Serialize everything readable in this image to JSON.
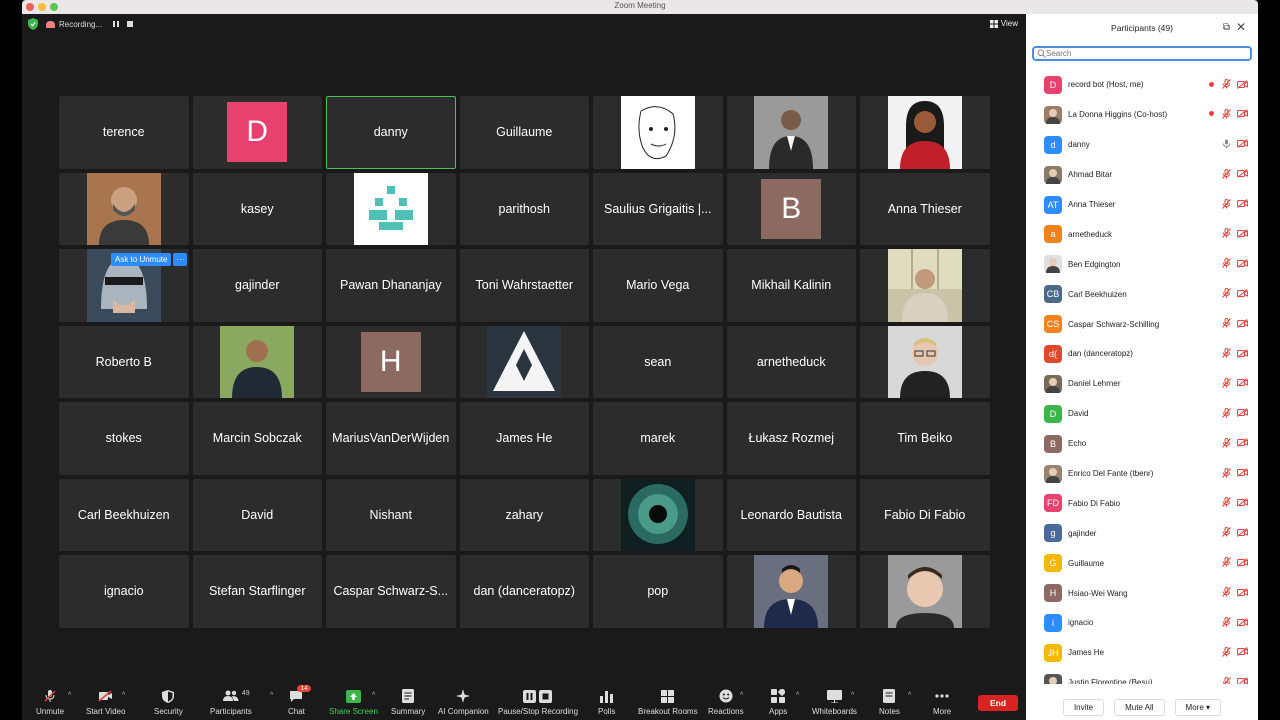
{
  "window": {
    "title": "Zoom Meeting"
  },
  "topbar": {
    "recording_label": "Recording...",
    "view_label": "View"
  },
  "tiles": [
    {
      "type": "name",
      "name": "terence"
    },
    {
      "type": "letter",
      "letter": "D",
      "color": "#e8416d"
    },
    {
      "type": "name",
      "name": "danny",
      "active": true
    },
    {
      "type": "name",
      "name": "Guillaume"
    },
    {
      "type": "photo",
      "photo": "sketch"
    },
    {
      "type": "photo",
      "photo": "woman-grey"
    },
    {
      "type": "photo",
      "photo": "woman-red"
    },
    {
      "type": "photo",
      "photo": "man-beard"
    },
    {
      "type": "name",
      "name": "kasey"
    },
    {
      "type": "photo",
      "photo": "teal-pixel"
    },
    {
      "type": "name",
      "name": "parithosh"
    },
    {
      "type": "name",
      "name": "Saulius Grigaitis |..."
    },
    {
      "type": "letter",
      "letter": "B",
      "color": "#8c6a62"
    },
    {
      "type": "name",
      "name": "Anna Thieser"
    },
    {
      "type": "photo",
      "photo": "robocop",
      "ask": true
    },
    {
      "type": "name",
      "name": "gajinder"
    },
    {
      "type": "name",
      "name": "Pawan Dhananjay"
    },
    {
      "type": "name",
      "name": "Toni Wahrstaetter"
    },
    {
      "type": "name",
      "name": "Mario Vega"
    },
    {
      "type": "name",
      "name": "Mikhail Kalinin"
    },
    {
      "type": "photo",
      "photo": "man-window"
    },
    {
      "type": "name",
      "name": "Roberto B"
    },
    {
      "type": "photo",
      "photo": "man-outdoor"
    },
    {
      "type": "letter",
      "letter": "H",
      "color": "#8c6a62"
    },
    {
      "type": "photo",
      "photo": "triangle"
    },
    {
      "type": "name",
      "name": "sean"
    },
    {
      "type": "name",
      "name": "arnetheduck"
    },
    {
      "type": "photo",
      "photo": "man-glasses"
    },
    {
      "type": "name",
      "name": "stokes"
    },
    {
      "type": "name",
      "name": "Marcin Sobczak"
    },
    {
      "type": "name",
      "name": "MariusVanDerWijden"
    },
    {
      "type": "name",
      "name": "James He"
    },
    {
      "type": "name",
      "name": "marek"
    },
    {
      "type": "name",
      "name": "Łukasz Rozmej"
    },
    {
      "type": "name",
      "name": "Tim Beiko"
    },
    {
      "type": "name",
      "name": "Carl Beekhuizen"
    },
    {
      "type": "name",
      "name": "David"
    },
    {
      "type": "name",
      "name": "Nishant"
    },
    {
      "type": "name",
      "name": "zahary"
    },
    {
      "type": "photo",
      "photo": "eye"
    },
    {
      "type": "name",
      "name": "Leonardo Bautista"
    },
    {
      "type": "name",
      "name": "Fabio Di Fabio"
    },
    {
      "type": "name",
      "name": "ignacio"
    },
    {
      "type": "name",
      "name": "Stefan Starflinger"
    },
    {
      "type": "name",
      "name": "Caspar Schwarz-S..."
    },
    {
      "type": "name",
      "name": "dan (danceratopz)"
    },
    {
      "type": "name",
      "name": "pop"
    },
    {
      "type": "photo",
      "photo": "man-suit"
    },
    {
      "type": "photo",
      "photo": "man-selfie"
    }
  ],
  "ask_to_unmute": {
    "label": "Ask to Unmute",
    "more": "···"
  },
  "toolbar": {
    "items": [
      {
        "id": "unmute",
        "label": "Unmute",
        "icon": "mic-muted-icon"
      },
      {
        "id": "video",
        "label": "Start Video",
        "icon": "video-off-icon"
      },
      {
        "id": "security",
        "label": "Security",
        "icon": "shield-icon"
      },
      {
        "id": "participants",
        "label": "Participants",
        "icon": "people-icon",
        "count": "49"
      },
      {
        "id": "chat",
        "label": "Chat",
        "icon": "chat-icon",
        "badge": "14"
      },
      {
        "id": "share",
        "label": "Share Screen",
        "icon": "share-screen-icon"
      },
      {
        "id": "summary",
        "label": "Summary",
        "icon": "summary-icon"
      },
      {
        "id": "ai",
        "label": "AI Companion",
        "icon": "sparkle-icon"
      },
      {
        "id": "rec",
        "label": "Pause/Stop Recording",
        "icon": "pause-stop-icon"
      },
      {
        "id": "polls",
        "label": "Polls",
        "icon": "polls-icon"
      },
      {
        "id": "breakout",
        "label": "Breakout Rooms",
        "icon": "breakout-icon"
      },
      {
        "id": "reactions",
        "label": "Reactions",
        "icon": "smiley-icon"
      },
      {
        "id": "apps",
        "label": "Apps",
        "icon": "apps-icon"
      },
      {
        "id": "whiteboards",
        "label": "Whiteboards",
        "icon": "whiteboard-icon"
      },
      {
        "id": "notes",
        "label": "Notes",
        "icon": "notes-icon"
      },
      {
        "id": "more",
        "label": "More",
        "icon": "more-icon"
      }
    ],
    "end_label": "End"
  },
  "panel": {
    "title": "Participants (49)",
    "search_placeholder": "Search",
    "participants": [
      {
        "name": "record bot (Host, me)",
        "initials": "D",
        "color": "#e8416d",
        "rec": true
      },
      {
        "name": "La Donna Higgins (Co-host)",
        "initials": "",
        "color": "#9c7e66",
        "photo": true,
        "rec": true
      },
      {
        "name": "danny",
        "initials": "d",
        "color": "#2d8cff",
        "mic_on": true
      },
      {
        "name": "Ahmad Bitar",
        "initials": "",
        "color": "#8a7a6a",
        "photo": true
      },
      {
        "name": "Anna Thieser",
        "initials": "AT",
        "color": "#2d8cff"
      },
      {
        "name": "arnetheduck",
        "initials": "a",
        "color": "#f0821e"
      },
      {
        "name": "Ben Edgington",
        "initials": "",
        "color": "#e0e0e0",
        "photo": true
      },
      {
        "name": "Carl Beekhuizen",
        "initials": "CB",
        "color": "#4a6a8a"
      },
      {
        "name": "Caspar Schwarz-Schilling",
        "initials": "CS",
        "color": "#f0821e"
      },
      {
        "name": "dan (danceratopz)",
        "initials": "d(",
        "color": "#e04a2a"
      },
      {
        "name": "Daniel Lehrner",
        "initials": "",
        "color": "#7a6a5a",
        "photo": true
      },
      {
        "name": "David",
        "initials": "D",
        "color": "#3cb54a"
      },
      {
        "name": "Echo",
        "initials": "B",
        "color": "#8c6a62"
      },
      {
        "name": "Enrico Del Fante (tbenr)",
        "initials": "",
        "color": "#9a8470",
        "photo": true
      },
      {
        "name": "Fabio Di Fabio",
        "initials": "FD",
        "color": "#e8416d"
      },
      {
        "name": "gajinder",
        "initials": "g",
        "color": "#4a6a9a"
      },
      {
        "name": "Guillaume",
        "initials": "G",
        "color": "#f5b800"
      },
      {
        "name": "Hsiao-Wei Wang",
        "initials": "H",
        "color": "#8c6a62"
      },
      {
        "name": "ignacio",
        "initials": "i",
        "color": "#2d8cff"
      },
      {
        "name": "James He",
        "initials": "JH",
        "color": "#f5b800"
      },
      {
        "name": "Justin Florentine (Besu)",
        "initials": "",
        "color": "#555",
        "photo": true
      }
    ],
    "footer": {
      "invite": "Invite",
      "mute_all": "Mute All",
      "more": "More"
    }
  }
}
